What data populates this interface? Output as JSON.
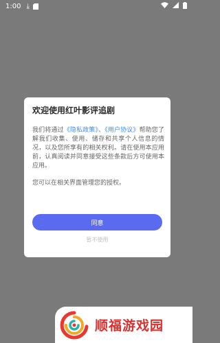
{
  "status_bar": {
    "time": "1:00",
    "icons": [
      "download-icon",
      "sd-card-icon",
      "wifi-icon",
      "signal-icon",
      "battery-icon"
    ]
  },
  "dialog": {
    "title": "欢迎使用红叶影评追剧",
    "text_before": "我们将通过",
    "privacy_link": "《隐私政策》",
    "separator": "、",
    "agreement_link": "《用户协议》",
    "text_after": "帮助您了解我们收集、使用、储存和共享个人信息的情况，以及您所享有的相关权利。请在使用本应用前，认真阅读并同意接受这些条款后方可使用本应用。",
    "note": "您可以在相关界面管理您的授权。",
    "agree_button": "同意",
    "decline_button": "暂不使用"
  },
  "brand": {
    "logo_icon": "shunfu-logo-icon",
    "name": "顺福游戏园"
  },
  "colors": {
    "overlay": "#7a7a7a",
    "link": "#3d8bff",
    "accent": "#5a6bf0",
    "brand": "#d6312e"
  }
}
